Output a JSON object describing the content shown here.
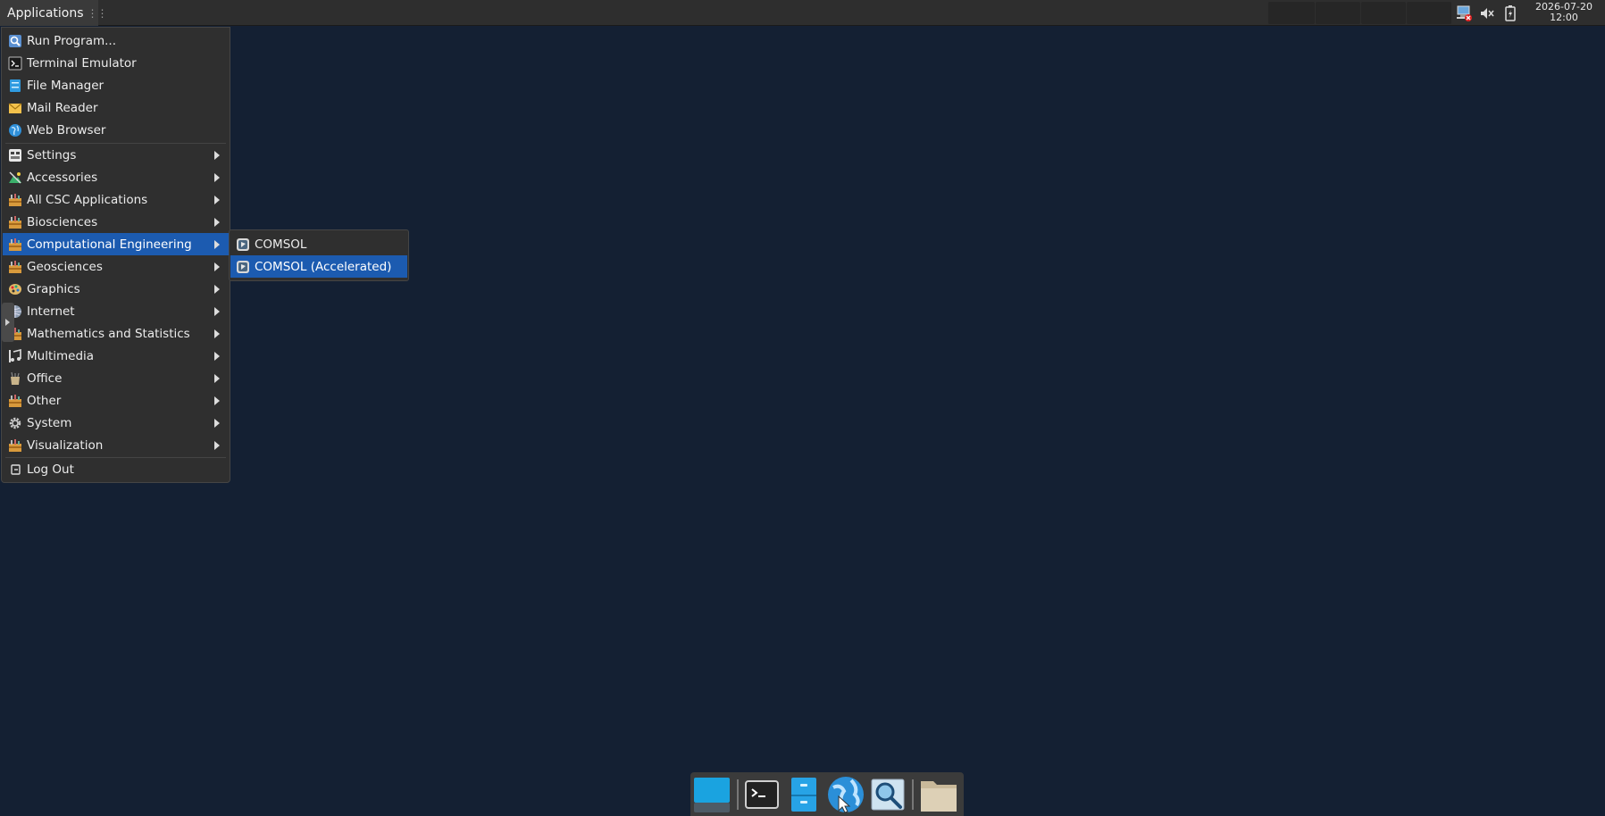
{
  "top_panel": {
    "applications_label": "Applications",
    "clock": {
      "date": "2026-07-20",
      "time": "12:00"
    }
  },
  "menu": {
    "items": [
      {
        "label": "Run Program...",
        "icon": "run-program-icon",
        "submenu": false
      },
      {
        "label": "Terminal Emulator",
        "icon": "terminal-icon",
        "submenu": false
      },
      {
        "label": "File Manager",
        "icon": "file-manager-icon",
        "submenu": false
      },
      {
        "label": "Mail Reader",
        "icon": "mail-icon",
        "submenu": false
      },
      {
        "label": "Web Browser",
        "icon": "web-browser-icon",
        "submenu": false
      },
      {
        "label": "Settings",
        "icon": "settings-icon",
        "submenu": true
      },
      {
        "label": "Accessories",
        "icon": "accessories-icon",
        "submenu": true
      },
      {
        "label": "All CSC Applications",
        "icon": "toolbox-icon",
        "submenu": true
      },
      {
        "label": "Biosciences",
        "icon": "toolbox-icon",
        "submenu": true
      },
      {
        "label": "Computational Engineering",
        "icon": "toolbox-icon",
        "submenu": true,
        "active": true
      },
      {
        "label": "Geosciences",
        "icon": "toolbox-icon",
        "submenu": true
      },
      {
        "label": "Graphics",
        "icon": "graphics-icon",
        "submenu": true
      },
      {
        "label": "Internet",
        "icon": "internet-icon",
        "submenu": true
      },
      {
        "label": "Mathematics and Statistics",
        "icon": "toolbox-icon",
        "submenu": true
      },
      {
        "label": "Multimedia",
        "icon": "multimedia-icon",
        "submenu": true
      },
      {
        "label": "Office",
        "icon": "office-icon",
        "submenu": true
      },
      {
        "label": "Other",
        "icon": "toolbox-icon",
        "submenu": true
      },
      {
        "label": "System",
        "icon": "system-gear-icon",
        "submenu": true
      },
      {
        "label": "Visualization",
        "icon": "toolbox-icon",
        "submenu": true
      },
      {
        "label": "Log Out",
        "icon": "log-out-icon",
        "submenu": false
      }
    ]
  },
  "submenu": {
    "items": [
      {
        "label": "COMSOL",
        "icon": "comsol-icon"
      },
      {
        "label": "COMSOL (Accelerated)",
        "icon": "comsol-icon",
        "active": true
      }
    ]
  },
  "dock": {
    "items": [
      "show-desktop-icon",
      "terminal-icon",
      "file-manager-icon",
      "web-browser-icon",
      "app-finder-icon",
      "folder-icon"
    ]
  },
  "colors": {
    "desktop": "#142033",
    "panel": "#2e2e2e",
    "menu_bg": "#2f2f2f",
    "highlight": "#1c5bb0"
  }
}
